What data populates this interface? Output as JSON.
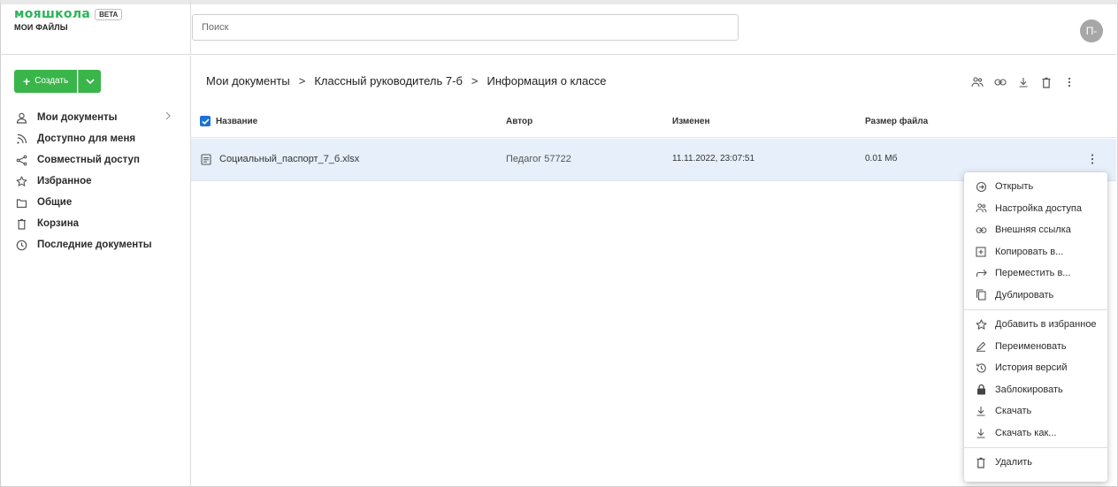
{
  "brand": {
    "name": "мояшкола",
    "badge": "BETA",
    "subtitle": "МОИ ФАЙЛЫ"
  },
  "search": {
    "placeholder": "Поиск"
  },
  "user": {
    "avatar_initial": "П-"
  },
  "sidebar": {
    "create_label": "Создать",
    "items": [
      {
        "label": "Мои документы",
        "icon": "person-icon",
        "active": true
      },
      {
        "label": "Доступно для меня",
        "icon": "rss-icon"
      },
      {
        "label": "Совместный доступ",
        "icon": "share-icon"
      },
      {
        "label": "Избранное",
        "icon": "star-icon"
      },
      {
        "label": "Общие",
        "icon": "folder-icon"
      },
      {
        "label": "Корзина",
        "icon": "trash-icon"
      },
      {
        "label": "Последние документы",
        "icon": "clock-icon"
      }
    ]
  },
  "breadcrumb": {
    "items": [
      "Мои документы",
      "Классный руководитель 7-б",
      "Информация о классе"
    ],
    "separator": ">"
  },
  "toolbar": {
    "icons": [
      "users-icon",
      "link-icon",
      "download-icon",
      "trash-icon",
      "more-vertical-icon"
    ]
  },
  "table": {
    "columns": [
      "Название",
      "Автор",
      "Изменен",
      "Размер файла"
    ],
    "rows": [
      {
        "name": "Социальный_паспорт_7_б.xlsx",
        "author": "Педагог 57722",
        "modified": "11.11.2022, 23:07:51",
        "size": "0.01 Мб"
      }
    ]
  },
  "context_menu": {
    "group1": [
      "Открыть",
      "Настройка доступа",
      "Внешняя ссылка",
      "Копировать в...",
      "Переместить в...",
      "Дублировать"
    ],
    "group2": [
      "Добавить в избранное",
      "Переименовать",
      "История версий",
      "Заблокировать",
      "Скачать",
      "Скачать как..."
    ],
    "group3": [
      "Удалить"
    ]
  },
  "colors": {
    "brand_green": "#2db35a",
    "button_green": "#3ab54a",
    "selection_blue": "#e6effa",
    "checkbox_blue": "#1c73d6"
  }
}
